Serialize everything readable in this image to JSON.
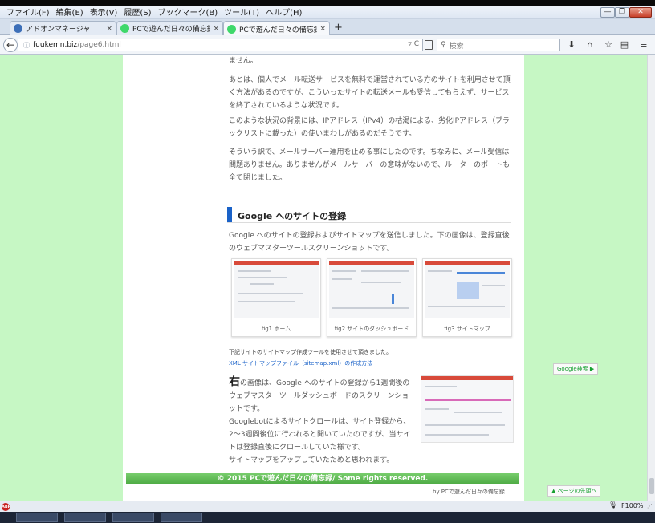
{
  "menu": {
    "items": [
      "ファイル(F)",
      "編集(E)",
      "表示(V)",
      "履歴(S)",
      "ブックマーク(B)",
      "ツール(T)",
      "ヘルプ(H)"
    ]
  },
  "window_controls": {
    "minimize": "—",
    "maximize": "❐",
    "close": "✕"
  },
  "tabs": [
    {
      "label": "アドオンマネージャ",
      "close": "×"
    },
    {
      "label": "PCで遊んだ日々の備忘録",
      "close": "×"
    },
    {
      "label": "PCで遊んだ日々の備忘録",
      "close": "×"
    }
  ],
  "new_tab_label": "+",
  "address": {
    "host": "fuukemn.biz",
    "path": "/page6.html",
    "tools": "▿ C"
  },
  "search": {
    "placeholder": "検索"
  },
  "page": {
    "para_top": "ません。",
    "para1": "あとは、個人でメール転送サービスを無料で運営されている方のサイトを利用させて頂く方法があるのですが、こういったサイトの転送メールも受信してもらえず、サービスを終了されているような状況です。",
    "para2": "このような状況の背景には、IPアドレス（IPv4）の枯渇による、劣化IPアドレス（ブラックリストに載った）の使いまわしがあるのだそうです。",
    "para3": "そういう訳で、メールサーバー運用を止める事にしたのです。ちなみに、メール受信は問題ありません。ありませんがメールサーバーの意味がないので、ルーターのポートも全て閉じました。",
    "section_title": "Google へのサイトの登録",
    "para4": "Google へのサイトの登録およびサイトマップを送信しました。下の画像は、登録直後のウェブマスターツールスクリーンショットです。",
    "figures": [
      {
        "caption": "fig1.ホーム"
      },
      {
        "caption": "fig2 サイトのダッシュボード"
      },
      {
        "caption": "fig3 サイトマップ"
      }
    ],
    "note": "下記サイトのサイトマップ作成ツールを使用させて頂きました。",
    "link": "XML サイトマップファイル（sitemap.xml）の作成方法",
    "big_char": "右",
    "right_para1": "の画像は、Google へのサイトの登録から1週間後のウェブマスターツールダッシュボードのスクリーンショットです。",
    "right_para2": "Googlebotによるサイトクロールは、サイト登録から、2〜3週間後位に行われると聞いていたのですが、当サイトは登録直後にクロールしていた様です。",
    "right_para3": "サイトマップをアップしていたためと思われます。",
    "footer": "© 2015 PCで遊んだ日々の備忘録/ Some rights reserved.",
    "by_line": "by PCで遊んだ日々の備忘録",
    "google_search_btn": "Google検索 ▶",
    "page_top_btn": "▲ ページの先頭へ"
  },
  "status": {
    "abp": "ABP",
    "zoom": "F100%"
  },
  "colors": {
    "page_bg": "#c6f7c4",
    "accent": "#1a62c8",
    "footer": "#5cb84e"
  },
  "icons": [
    "back-arrow-icon",
    "reader-view-icon",
    "search-icon",
    "download-icon",
    "home-icon",
    "bookmark-star-icon",
    "bookmarks-list-icon",
    "hamburger-menu-icon",
    "microphone-icon"
  ]
}
